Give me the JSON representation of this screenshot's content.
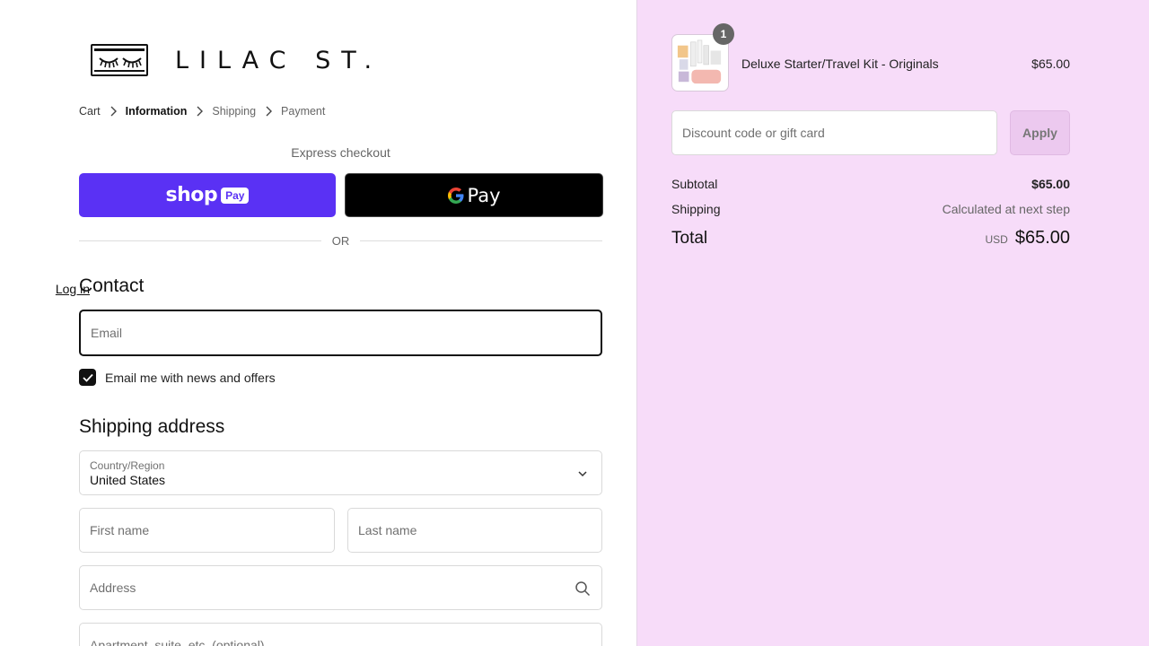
{
  "brand": {
    "name": "LILAC ST."
  },
  "breadcrumb": {
    "cart": "Cart",
    "information": "Information",
    "shipping": "Shipping",
    "payment": "Payment"
  },
  "express": {
    "label": "Express checkout",
    "shop_word": "shop",
    "shop_pay": "Pay",
    "gpay_g": "G",
    "gpay_word": "Pay",
    "or": "OR"
  },
  "contact": {
    "title": "Contact",
    "login": "Log in",
    "email_placeholder": "Email",
    "newsletter_label": "Email me with news and offers",
    "newsletter_checked": true
  },
  "shipping_address": {
    "title": "Shipping address",
    "country_label": "Country/Region",
    "country_value": "United States",
    "first_name_placeholder": "First name",
    "last_name_placeholder": "Last name",
    "address_placeholder": "Address",
    "apartment_placeholder": "Apartment, suite, etc. (optional)"
  },
  "order": {
    "item": {
      "quantity": "1",
      "name": "Deluxe Starter/Travel Kit - Originals",
      "price": "$65.00"
    },
    "discount_placeholder": "Discount code or gift card",
    "apply_label": "Apply",
    "subtotal_label": "Subtotal",
    "subtotal_value": "$65.00",
    "shipping_label": "Shipping",
    "shipping_value": "Calculated at next step",
    "total_label": "Total",
    "total_currency": "USD",
    "total_value": "$65.00"
  },
  "colors": {
    "shop_pay": "#5a31f4",
    "sidebar_bg": "#f7dcf9",
    "apply_bg": "#ecc9ef"
  }
}
